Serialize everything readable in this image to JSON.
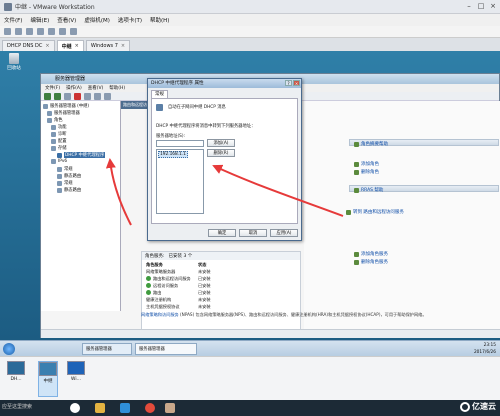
{
  "vmware": {
    "title": "中继 - VMware Workstation",
    "menu": [
      "文件(F)",
      "编辑(E)",
      "查看(V)",
      "虚拟机(M)",
      "选项卡(T)",
      "帮助(H)"
    ],
    "tabs": [
      {
        "label": "DHCP DNS DC",
        "active": false
      },
      {
        "label": "中继",
        "active": true
      },
      {
        "label": "Windows 7",
        "active": false
      }
    ]
  },
  "desktop": {
    "recycle_label": "回收站"
  },
  "server_manager": {
    "title": "服务器管理器",
    "menu": [
      "文件(F)",
      "操作(A)",
      "查看(V)",
      "帮助(H)"
    ],
    "tree": [
      "服务器管理器 (中继)",
      "服务器管理器",
      "角色",
      "功能",
      "诊断",
      "配置",
      "存储",
      "DHCP 中继代理程序",
      "IPv6",
      "常规",
      "静态路由",
      "常规",
      "静态路由"
    ],
    "mid_header": "路由和远程访问",
    "right_links": [
      "角色摘要帮助",
      "添加角色",
      "删除角色",
      "RRAS 帮助",
      "转到 路由和远程访问服务",
      "添加角色服务",
      "删除角色服务"
    ],
    "roles": {
      "header": "角色服务:",
      "count_label": "已安装 3 个",
      "rows": [
        {
          "name": "角色服务",
          "state": "状态"
        },
        {
          "name": "网络策略服务器",
          "state": "未安装"
        },
        {
          "name": "路由和远程访问服务",
          "state": "已安装"
        },
        {
          "name": "远程访问服务",
          "state": "已安装"
        },
        {
          "name": "路由",
          "state": "已安装"
        },
        {
          "name": "健康注册机构",
          "state": "未安装"
        },
        {
          "name": "主机凭据授权协议",
          "state": "未安装"
        }
      ]
    },
    "description_link": "网络策略和访问服务",
    "description": "(NPAS) 包含网络策略服务器(NPS)、路由和远程访问服务、健康注册机构(HRA)和主机凭据授权协议(HCAP)，可用于帮助保护网络。",
    "refresh": "上次刷新时间: 今天 23:15:24 配置刷新"
  },
  "dialog": {
    "title": "DHCP 中继代理程序 属性",
    "tab": "常规",
    "line1": "自动在子网间中继 DHCP 消息",
    "line2": "DHCP 中继代理程序将消息中转到下列服务器地址：",
    "addr_label": "服务器地址(S):",
    "add_btn": "添加(A)",
    "remove_btn": "删除(R)",
    "entry": "192.168.1.1",
    "help_link": "",
    "ok": "确定",
    "cancel": "取消",
    "apply": "应用(A)"
  },
  "guest_taskbar": {
    "task": "服务器管理器",
    "task2": "服务器管理器",
    "time": "23:15",
    "date": "2017/6/26"
  },
  "thumbnails": [
    {
      "label": "DH..."
    },
    {
      "label": "中继"
    },
    {
      "label": "Wi..."
    }
  ],
  "host_taskbar": {
    "search": "应至这里搜索"
  },
  "watermark": "亿速云",
  "colors": {
    "accent": "#3a6ea5",
    "arrow": "#e63a3a",
    "desktop": "#1f5f86"
  }
}
